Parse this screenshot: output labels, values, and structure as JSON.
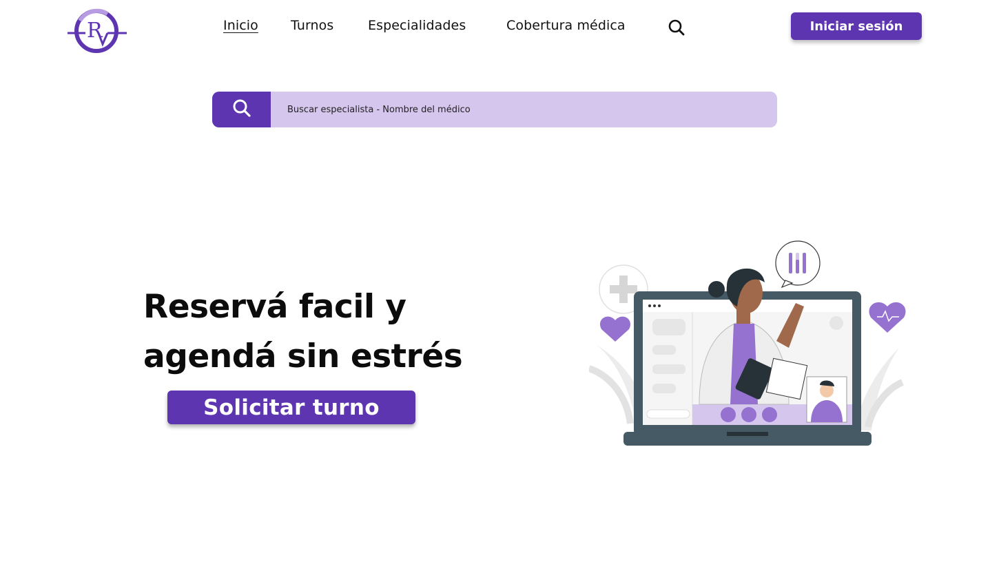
{
  "brand": {
    "logo_letters": "RV",
    "accent": "#5e35b1",
    "accent_light": "#d5c6ee"
  },
  "nav": {
    "items": [
      {
        "label": "Inicio",
        "active": true
      },
      {
        "label": "Turnos",
        "active": false
      },
      {
        "label": "Especialidades",
        "active": false
      },
      {
        "label": "Cobertura médica",
        "active": false
      }
    ],
    "search_icon": "search-icon",
    "login_label": "Iniciar sesión"
  },
  "search": {
    "placeholder": "Buscar especialista - Nombre del médico",
    "value": "",
    "icon": "search-icon"
  },
  "hero": {
    "title_line1": "Reservá facil y",
    "title_line2": "agendá sin estrés",
    "cta_label": "Solicitar turno"
  }
}
